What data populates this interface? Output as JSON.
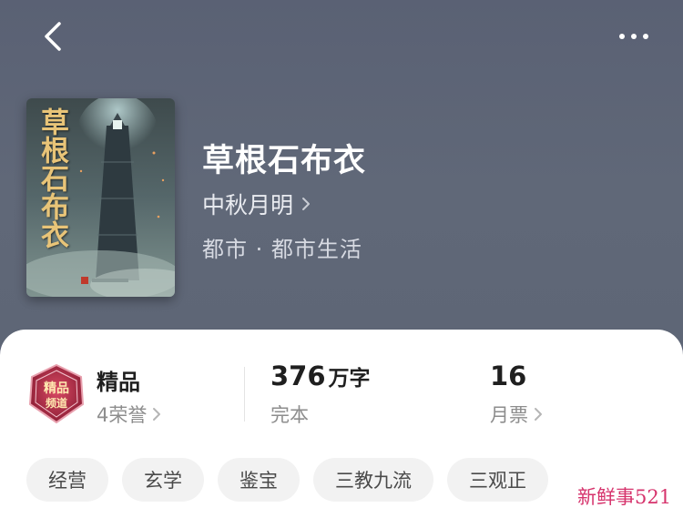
{
  "book": {
    "title": "草根石布衣",
    "cover_text": "草根石布衣",
    "author": "中秋月明",
    "genre": "都市 · 都市生活"
  },
  "stats": {
    "quality": {
      "label": "精品",
      "honors": "4荣誉"
    },
    "words": {
      "value": "376",
      "unit": "万字",
      "status": "完本"
    },
    "monthly_votes": {
      "value": "16",
      "label": "月票"
    }
  },
  "badge": {
    "text": "精品",
    "subtext": "频道"
  },
  "tags": [
    "经营",
    "玄学",
    "鉴宝",
    "三教九流",
    "三观正"
  ],
  "watermark": "新鲜事521",
  "icons": {
    "back": "chevron-left-icon",
    "more": "more-dots-icon",
    "chevron": "chevron-right-icon"
  },
  "colors": {
    "header_bg": "#5e6676",
    "card_bg": "#ffffff",
    "tag_bg": "#f2f2f2",
    "watermark": "#d6336c",
    "badge": "#b8324e"
  }
}
